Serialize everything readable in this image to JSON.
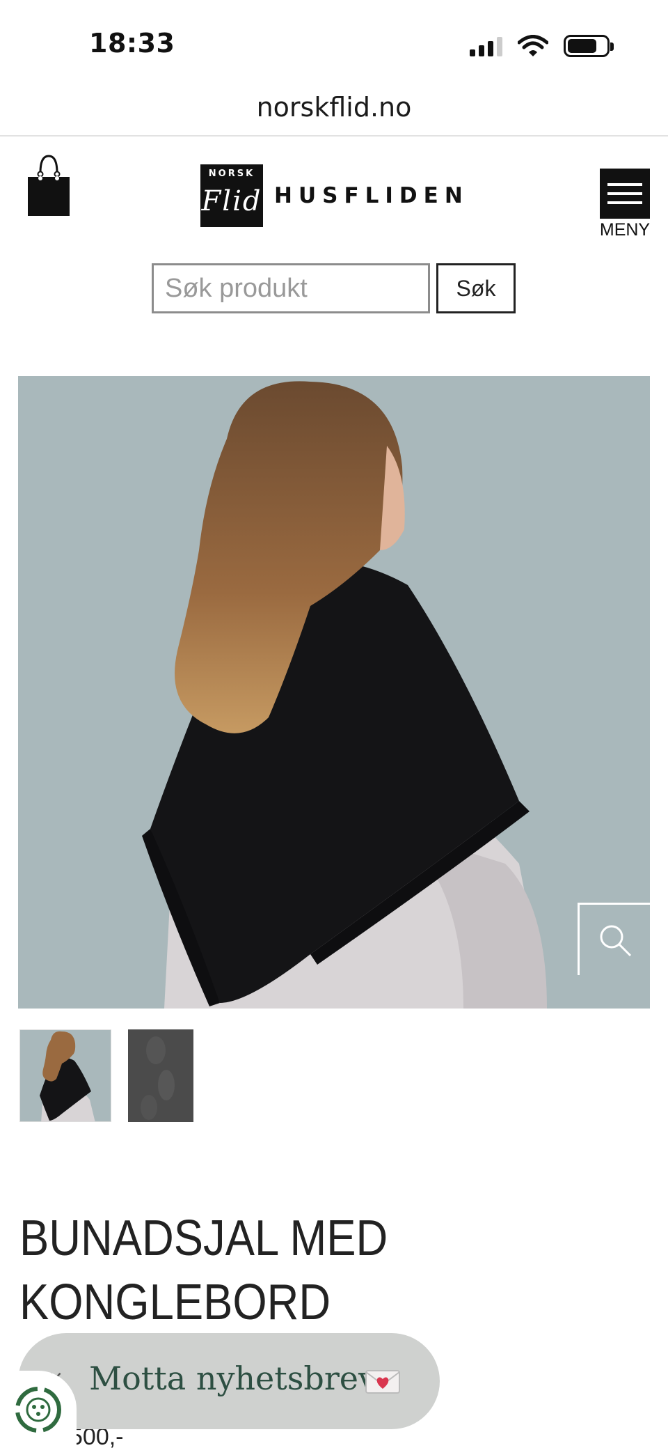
{
  "status_bar": {
    "time": "18:33"
  },
  "browser": {
    "url": "norskflid.no"
  },
  "header": {
    "logo_norsk": "NORSK",
    "logo_flid": "Flid",
    "logo_husfliden": "HUSFLIDEN",
    "menu_label": "MENY"
  },
  "search": {
    "placeholder": "Søk produkt",
    "button_label": "Søk"
  },
  "product": {
    "title_line1": "BUNADSJAL MED",
    "title_line2": "KONGLEBORD",
    "price_partial": "500,-"
  },
  "newsletter": {
    "label": "Motta nyhetsbrev",
    "close_icon": "×"
  },
  "colors": {
    "image_background": "#a9b8bb",
    "newsletter_background": "#cfd1cf",
    "newsletter_text": "#2d4f42",
    "eco_green": "#2f6b3f"
  },
  "icons": [
    "cart-bag-icon",
    "menu-icon",
    "zoom-icon",
    "close-icon",
    "envelope-heart-icon",
    "eco-badge-icon",
    "signal-icon",
    "wifi-icon",
    "battery-icon"
  ]
}
